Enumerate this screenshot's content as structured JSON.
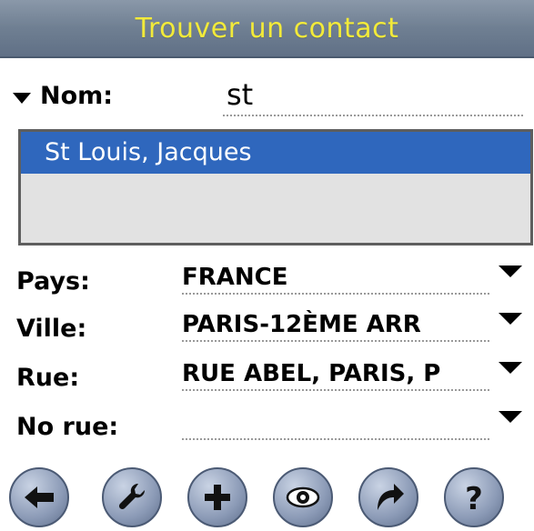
{
  "title": "Trouver un contact",
  "search": {
    "label": "Nom:",
    "value": "st"
  },
  "results": [
    "St Louis, Jacques"
  ],
  "fields": {
    "pays": {
      "label": "Pays:",
      "value": "FRANCE"
    },
    "ville": {
      "label": "Ville:",
      "value": "PARIS-12ÈME ARR"
    },
    "rue": {
      "label": "Rue:",
      "value": "RUE ABEL, PARIS, P"
    },
    "no_rue": {
      "label": "No rue:",
      "value": ""
    }
  },
  "toolbar": {
    "icons": [
      "back-arrow-icon",
      "wrench-icon",
      "plus-icon",
      "eye-icon",
      "redo-arrow-icon",
      "help-icon"
    ]
  },
  "colors": {
    "title_text": "#f2ea3a",
    "title_bar": "#6f7f92",
    "selection": "#2f67bd",
    "list_bg": "#e2e2e2"
  }
}
